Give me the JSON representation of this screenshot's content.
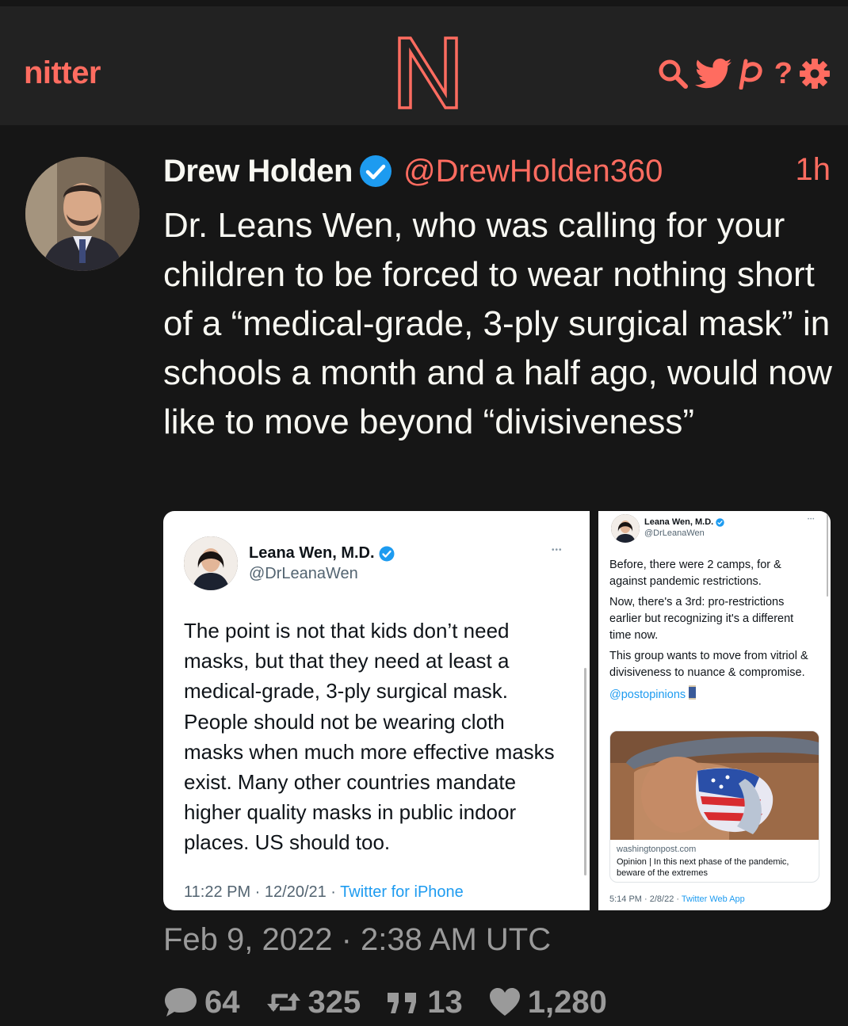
{
  "nav": {
    "brand": "nitter",
    "logo_letter": "N",
    "icons": [
      "search-icon",
      "twitter-bird-icon",
      "rss-icon",
      "help-icon",
      "gear-icon"
    ],
    "help_label": "?"
  },
  "tweet": {
    "fullname": "Drew Holden",
    "username": "@DrewHolden360",
    "time": "1h",
    "verified": true,
    "text": "Dr. Leans Wen, who was calling for your children to be forced to wear nothing short of a “medical-grade, 3-ply surgical mask” in schools a month and a half ago, would now like to move beyond “divisiveness”",
    "date": "Feb 9, 2022 · 2:38 AM UTC",
    "stats": {
      "replies": "64",
      "retweets": "325",
      "quotes": "13",
      "likes": "1,280"
    }
  },
  "embedded_left": {
    "name": "Leana Wen, M.D.",
    "handle": "@DrLeanaWen",
    "dots": "•••",
    "text": "The point is not that kids don’t need masks, but that they need at least a medical-grade, 3-ply surgical mask. People should not be wearing cloth masks when much more effective masks exist. Many other countries mandate higher quality masks in public indoor places. US should too.",
    "meta_time": "11:22 PM · 12/20/21 · ",
    "meta_source": "Twitter for iPhone"
  },
  "embedded_right": {
    "name": "Leana Wen, M.D.",
    "handle": "@DrLeanaWen",
    "dots": "•••",
    "para1": "Before, there were 2 camps, for & against pandemic restrictions.",
    "para2": "Now, there's a 3rd: pro-restrictions earlier but recognizing it's a different time now.",
    "para3": "This group wants to move from vitriol & divisiveness to nuance & compromise.",
    "link": "@postopinions",
    "card_domain": "washingtonpost.com",
    "card_title": "Opinion | In this next phase of the pandemic, beware of the extremes",
    "meta_time": "5:14 PM · 2/8/22 · ",
    "meta_source": "Twitter Web App"
  },
  "colors": {
    "accent": "#ff6c60",
    "background": "#161616",
    "navbar": "#222222",
    "text": "#f8f8f2",
    "muted": "#9a9a9a",
    "twitter_blue": "#1d9bf0"
  }
}
